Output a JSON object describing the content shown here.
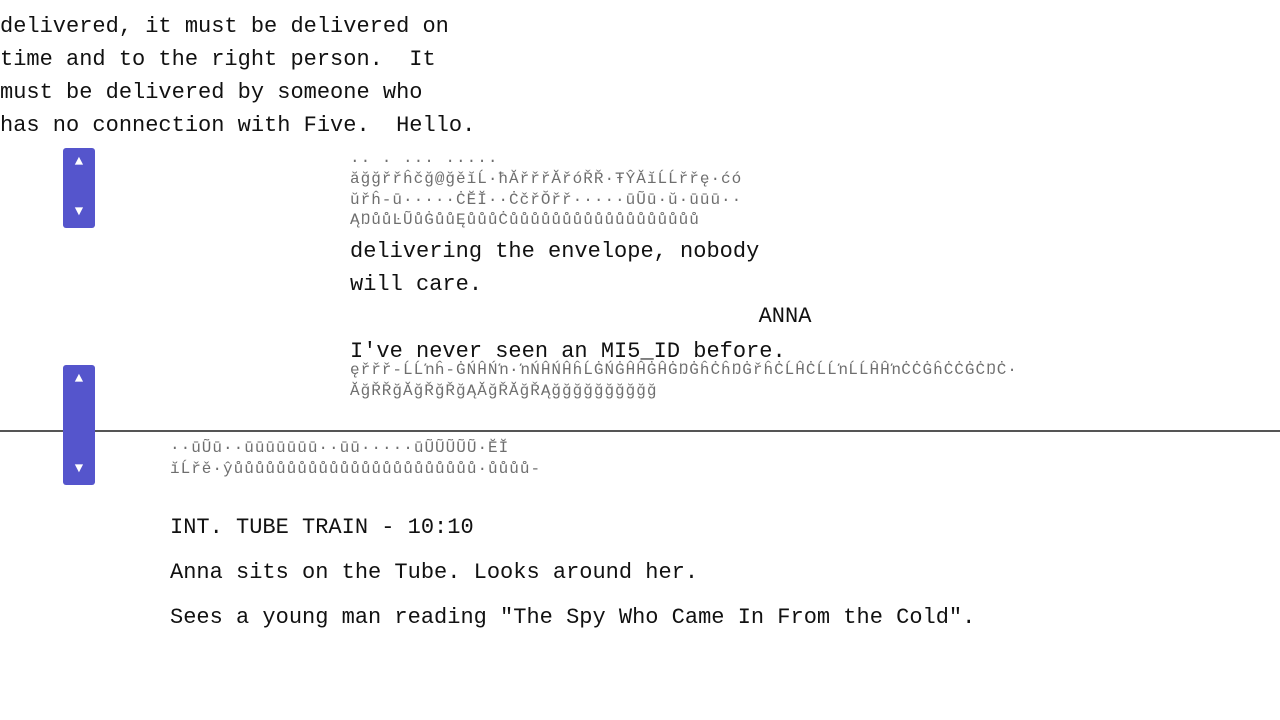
{
  "content": {
    "top_paragraph": "delivered, it must be delivered on\ntime and to the right person.  It\nmust be delivered by someone who\nhas no connection with Five.  Hello.",
    "corrupted_top_line1": ".. . ... .....",
    "corrupted_top_line2": "ăğğřřĥčğ@ğěĭĹ·ħĂřřřĂřóŘŘ·ŦŶĂĭĹĹřřę·ćó",
    "corrupted_top_line3": "ŭřĥ-ū·····ĊĔĬ··ĊčřŎřř·····ūŨū·ŭ·ūūū··",
    "corrupted_top_line4": "ĄŊůůĿŨůĠůůĘůůůĊůůůůůůůůůůůůůůůůůů",
    "clean_line": "delivering the envelope, nobody\nwill care.",
    "anna_name": "ANNA",
    "anna_dialogue": "I've never seen an MI5_ID before.",
    "corrupted_mid_line1": "ęřřř-ĹĹŉĥ-ĠŃĤŃŉ·ŉŃĤŃĤĥĹĠŃĠĤĤĠĤĠŊĠĥĊĥŊĠřĥĊĹĤĊĹĹŉĹĹĤĤŉĊĊĠĥĊĊĠĊŊĊ·",
    "corrupted_mid_line2": "ĂğŘŘğĂğŘğŘğĄĂğŘĂğŘĄğğğğğğğğğğ",
    "corrupted_lower_line1": "··ūŨū··ūūūūūūū··ūū·····ūŨŨŨŨŨ·ĔĬ",
    "corrupted_lower_line2": "ĭĹřě·ŷůůůůůůůůůůůůůůůůůůůůůůů·ůůůů-",
    "scene_heading": "INT. TUBE TRAIN - 10:10",
    "action_line1": "Anna sits on the Tube.  Looks around her.",
    "action_line2": "Sees a young man reading \"The Spy Who Came In From the Cold\".",
    "scrollbar1": {
      "up_arrow": "▲",
      "down_arrow": "▼"
    },
    "scrollbar2": {
      "up_arrow": "▲",
      "down_arrow": "▼"
    }
  }
}
